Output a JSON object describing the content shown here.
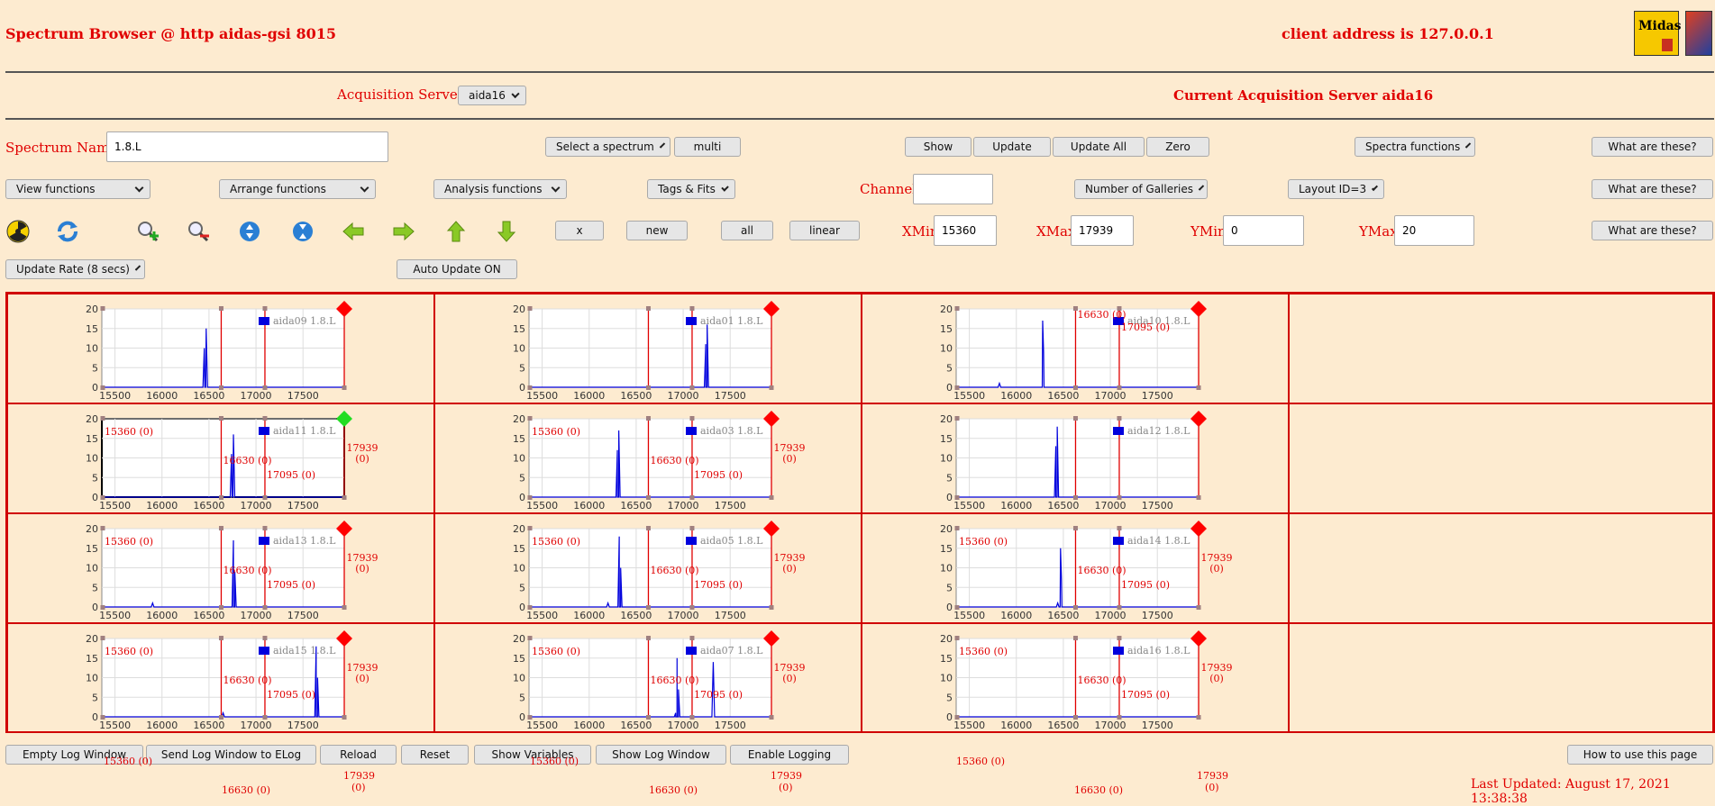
{
  "header": {
    "title": "Spectrum Browser @ http aidas-gsi 8015",
    "client": "client address is 127.0.0.1",
    "logo_text": "Midas"
  },
  "acq": {
    "label": "Acquisition Servers",
    "server_select": "aida16",
    "current": "Current Acquisition Server aida16"
  },
  "row1": {
    "spectrum_name_label": "Spectrum Name:",
    "spectrum_name_value": "1.8.L",
    "select_spectrum": "Select a spectrum",
    "multi": "multi",
    "show": "Show",
    "update": "Update",
    "update_all": "Update All",
    "zero": "Zero",
    "spectra_functions": "Spectra functions",
    "what": "What are these?"
  },
  "row2": {
    "view_functions": "View functions",
    "arrange_functions": "Arrange functions",
    "analysis_functions": "Analysis functions",
    "tags_fits": "Tags & Fits",
    "channel_label": "Channel:",
    "channel_value": "",
    "num_galleries": "Number of Galleries",
    "layout": "Layout ID=3",
    "what": "What are these?"
  },
  "row3": {
    "x": "x",
    "new": "new",
    "all": "all",
    "linear": "linear",
    "xmin_label": "XMin",
    "xmin_value": "15360",
    "xmax_label": "XMax",
    "xmax_value": "17939",
    "ymin_label": "YMin",
    "ymin_value": "0",
    "ymax_label": "YMax",
    "ymax_value": "20",
    "what": "What are these?",
    "icons": [
      "radiation-icon",
      "refresh-icon",
      "zoom-in-icon",
      "zoom-out-icon",
      "expand-vertical-icon",
      "compress-vertical-icon",
      "arrow-left-icon",
      "arrow-right-icon",
      "arrow-up-icon",
      "arrow-down-icon"
    ]
  },
  "row4": {
    "update_rate": "Update Rate (8 secs)",
    "auto_update": "Auto Update ON"
  },
  "plots": {
    "xlim": [
      15360,
      17939
    ],
    "ylim": [
      0,
      20
    ],
    "xticks": [
      "15500",
      "16000",
      "16500",
      "17000",
      "17500"
    ],
    "yticks": [
      "0",
      "5",
      "10",
      "15",
      "20"
    ],
    "markers": {
      "m1": "15360 (0)",
      "m2": "16630 (0)",
      "m3": "17095 (0)",
      "m4a": "17939",
      "m4b": "(0)"
    },
    "cells": [
      {
        "label": "aida09 1.8.L",
        "peaks": [
          16450,
          16470
        ],
        "ann": "none",
        "active": false
      },
      {
        "label": "aida01 1.8.L",
        "peaks": [
          17240,
          17255
        ],
        "ann": "none",
        "active": false
      },
      {
        "label": "aida10 1.8.L",
        "peaks": [
          15820,
          16280,
          16290
        ],
        "ann": "top",
        "active": false
      },
      {
        "label": "aida11 1.8.L",
        "peaks": [
          16740,
          16760
        ],
        "ann": "full",
        "active": true
      },
      {
        "label": "aida03 1.8.L",
        "peaks": [
          16300,
          16315
        ],
        "ann": "full",
        "active": false
      },
      {
        "label": "aida12 1.8.L",
        "peaks": [
          16420,
          16435
        ],
        "ann": "none",
        "active": false
      },
      {
        "label": "aida13 1.8.L",
        "peaks": [
          15900,
          16760,
          16775
        ],
        "ann": "full",
        "active": false
      },
      {
        "label": "aida05 1.8.L",
        "peaks": [
          16200,
          16320,
          16335
        ],
        "ann": "full",
        "active": false
      },
      {
        "label": "aida14 1.8.L",
        "peaks": [
          16440,
          16470,
          16480
        ],
        "ann": "full",
        "active": false
      },
      {
        "label": "aida15 1.8.L",
        "peaks": [
          16650,
          17640,
          17655
        ],
        "ann": "full",
        "active": false
      },
      {
        "label": "aida07 1.8.L",
        "peaks": [
          16920,
          16935,
          16950,
          17320
        ],
        "ann": "full",
        "active": false
      },
      {
        "label": "aida16 1.8.L",
        "peaks": [],
        "ann": "full",
        "active": false
      }
    ],
    "colors": {
      "trace": "#0000dd",
      "marker": "#e00000",
      "grid": "#dddddd",
      "ok": "#22dd22"
    }
  },
  "bottom": {
    "empty_log": "Empty Log Window",
    "send_log": "Send Log Window to ELog",
    "reload": "Reload",
    "reset": "Reset",
    "show_vars": "Show Variables",
    "show_log": "Show Log Window",
    "enable_logging": "Enable Logging",
    "howto": "How to use this page",
    "last_updated": "Last Updated: August 17, 2021 13:38:38"
  }
}
